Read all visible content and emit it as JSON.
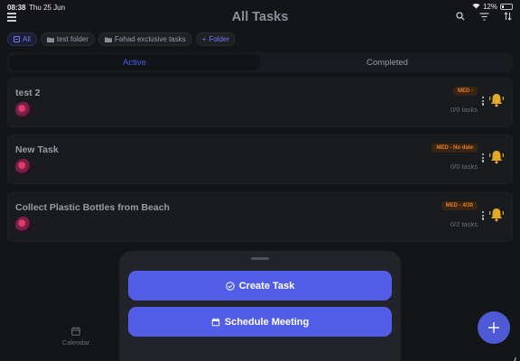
{
  "status_bar": {
    "time": "08:38",
    "date": "Thu 25 Jun",
    "battery": "12%"
  },
  "header": {
    "title": "All Tasks",
    "icons": [
      "menu-icon",
      "search-icon",
      "filter-icon",
      "sort-icon"
    ]
  },
  "folders": [
    {
      "label": "All",
      "icon": "all-icon",
      "active": true
    },
    {
      "label": "test folder",
      "icon": "folder-icon"
    },
    {
      "label": "Fahad exclusive tasks",
      "icon": "folder-icon"
    },
    {
      "label": "Folder",
      "icon": "plus-icon",
      "add": true
    }
  ],
  "tabs": [
    {
      "label": "Active",
      "active": true
    },
    {
      "label": "Completed"
    }
  ],
  "tasks": [
    {
      "title": "test 2",
      "badge": "MED -",
      "progress": "0/0 tasks"
    },
    {
      "title": "New Task",
      "badge": "MED - No date",
      "progress": "0/0 tasks"
    },
    {
      "title": "Collect Plastic Bottles from Beach",
      "badge": "MED - 4/30",
      "progress": "0/2 tasks"
    }
  ],
  "bottom_nav": {
    "calendar_label": "Calendar"
  },
  "sheet": {
    "create_task_label": "Create Task",
    "schedule_meeting_label": "Schedule Meeting"
  },
  "colors": {
    "accent": "#525ee8",
    "bell": "#e0a92a",
    "badge_text": "#e07f2a",
    "background": "#141518"
  }
}
